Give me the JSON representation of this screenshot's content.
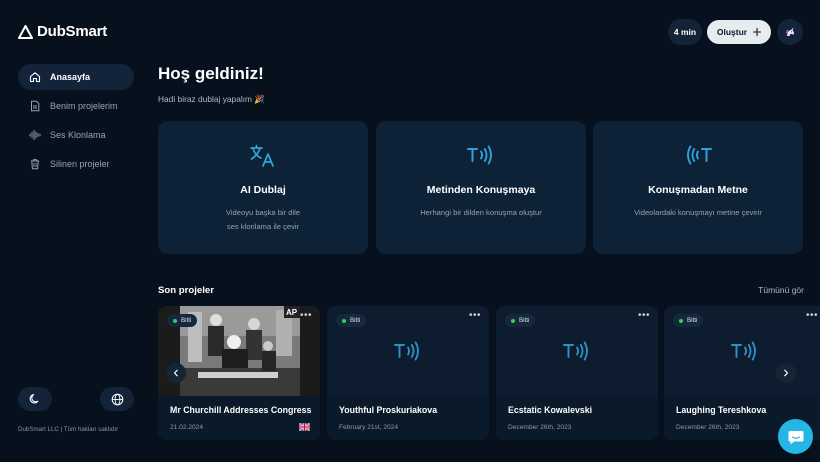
{
  "app": {
    "logo_text": "DubSmart"
  },
  "sidebar": {
    "items": [
      {
        "label": "Anasayfa",
        "icon": "home-icon",
        "active": true
      },
      {
        "label": "Benim projelerim",
        "icon": "document-icon",
        "active": false
      },
      {
        "label": "Ses Klonlama",
        "icon": "waveform-icon",
        "active": false
      },
      {
        "label": "Silinen projeler",
        "icon": "trash-icon",
        "active": false
      }
    ],
    "theme_icon": "moon-icon",
    "language_icon": "globe-icon",
    "footer": "DubSmart LLC | Tüm hakları saklıdır"
  },
  "header": {
    "time_remaining": "4 min",
    "create_label": "Oluştur",
    "create_icon": "plus-icon",
    "avatar_icon": "unicorn-avatar-icon"
  },
  "welcome": {
    "title": "Hoş geldiniz!",
    "subtitle": "Hadi biraz dublaj yapalım 🎉"
  },
  "features": [
    {
      "title": "AI Dublaj",
      "desc_line1": "Videoyu başka bir dile",
      "desc_line2": "ses klonlama ile çevir",
      "icon": "translate-icon"
    },
    {
      "title": "Metinden Konuşmaya",
      "desc_line1": "Herhangi bir dilden konuşma oluştur",
      "desc_line2": "",
      "icon": "text-to-speech-icon"
    },
    {
      "title": "Konuşmadan Metne",
      "desc_line1": "Videolardaki konuşmayı metine çevirir",
      "desc_line2": "",
      "icon": "speech-to-text-icon"
    }
  ],
  "recent": {
    "title": "Son projeler",
    "see_all": "Tümünü gör",
    "projects": [
      {
        "name": "Mr Churchill Addresses Congress",
        "date": "21.02.2024",
        "status": "Bitti",
        "thumbnail": "video-frame",
        "flag": "uk-flag-icon"
      },
      {
        "name": "Youthful Proskuriakova",
        "date": "February 21st, 2024",
        "status": "Bitti",
        "thumbnail": "text-to-speech-icon"
      },
      {
        "name": "Ecstatic Kowalevski",
        "date": "December 26th, 2023",
        "status": "Bitti",
        "thumbnail": "text-to-speech-icon"
      },
      {
        "name": "Laughing Tereshkova",
        "date": "December 26th, 2023",
        "status": "Bitti",
        "thumbnail": "text-to-speech-icon"
      }
    ],
    "more_label": "•••"
  },
  "colors": {
    "background": "#07111d",
    "card": "#0e2237",
    "accent": "#2ea3d8",
    "status_green": "#2ed05b",
    "chat_button": "#25b5e6"
  }
}
